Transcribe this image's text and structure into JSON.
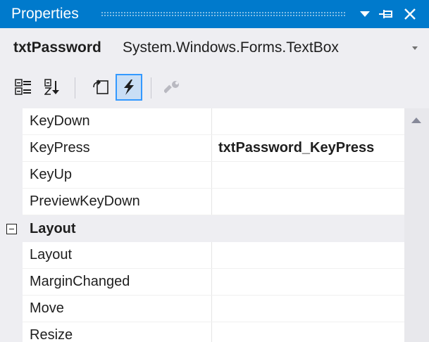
{
  "window": {
    "title": "Properties"
  },
  "object_selector": {
    "name": "txtPassword",
    "type": "System.Windows.Forms.TextBox"
  },
  "toolbar": {
    "buttons": [
      {
        "icon": "categorized-icon",
        "active": false
      },
      {
        "icon": "alphabetical-icon",
        "active": false
      },
      {
        "icon": "properties-icon",
        "active": false
      },
      {
        "icon": "events-lightning-icon",
        "active": true
      },
      {
        "icon": "property-pages-wrench-icon",
        "active": false,
        "disabled": true
      }
    ]
  },
  "grid": {
    "rows": [
      {
        "name": "KeyDown",
        "value": ""
      },
      {
        "name": "KeyPress",
        "value": "txtPassword_KeyPress"
      },
      {
        "name": "KeyUp",
        "value": ""
      },
      {
        "name": "PreviewKeyDown",
        "value": ""
      }
    ],
    "category": {
      "label": "Layout",
      "expanded": true
    },
    "category_rows": [
      {
        "name": "Layout",
        "value": ""
      },
      {
        "name": "MarginChanged",
        "value": ""
      },
      {
        "name": "Move",
        "value": ""
      },
      {
        "name": "Resize",
        "value": ""
      }
    ]
  },
  "colors": {
    "title_bar": "#007acc",
    "panel": "#eeeef2",
    "active_tool_border": "#3399ff"
  }
}
